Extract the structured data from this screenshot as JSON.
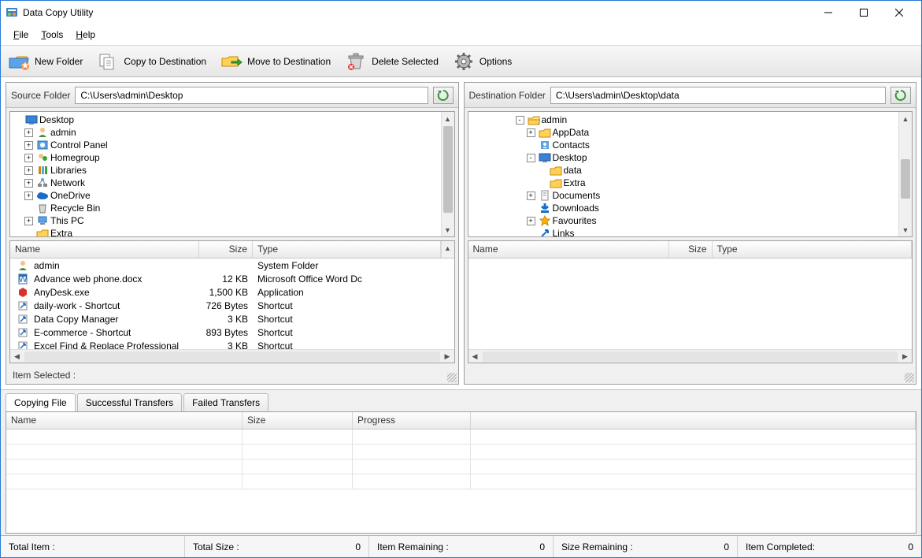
{
  "window": {
    "title": "Data Copy Utility"
  },
  "menu": {
    "file": "File",
    "tools": "Tools",
    "help": "Help"
  },
  "toolbar": {
    "new_folder": "New Folder",
    "copy": "Copy to Destination",
    "move": "Move to Destination",
    "delete": "Delete Selected",
    "options": "Options"
  },
  "source": {
    "label": "Source Folder",
    "path": "C:\\Users\\admin\\Desktop",
    "tree": [
      {
        "indent": 0,
        "exp": "",
        "icon": "desktop",
        "label": "Desktop"
      },
      {
        "indent": 1,
        "exp": "+",
        "icon": "user",
        "label": "admin"
      },
      {
        "indent": 1,
        "exp": "+",
        "icon": "cpl",
        "label": "Control Panel"
      },
      {
        "indent": 1,
        "exp": "+",
        "icon": "home",
        "label": "Homegroup"
      },
      {
        "indent": 1,
        "exp": "+",
        "icon": "lib",
        "label": "Libraries"
      },
      {
        "indent": 1,
        "exp": "+",
        "icon": "net",
        "label": "Network"
      },
      {
        "indent": 1,
        "exp": "+",
        "icon": "cloud",
        "label": "OneDrive"
      },
      {
        "indent": 1,
        "exp": "",
        "icon": "bin",
        "label": "Recycle Bin"
      },
      {
        "indent": 1,
        "exp": "+",
        "icon": "pc",
        "label": "This PC"
      },
      {
        "indent": 1,
        "exp": "",
        "icon": "folder",
        "label": "Extra"
      }
    ],
    "cols": {
      "name": "Name",
      "size": "Size",
      "type": "Type"
    },
    "items": [
      {
        "icon": "user",
        "name": "admin",
        "size": "",
        "type": "System Folder"
      },
      {
        "icon": "docx",
        "name": "Advance web phone.docx",
        "size": "12 KB",
        "type": "Microsoft Office Word Dc"
      },
      {
        "icon": "exe",
        "name": "AnyDesk.exe",
        "size": "1,500 KB",
        "type": "Application"
      },
      {
        "icon": "lnk",
        "name": "daily-work - Shortcut",
        "size": "726 Bytes",
        "type": "Shortcut"
      },
      {
        "icon": "lnk",
        "name": "Data Copy Manager",
        "size": "3 KB",
        "type": "Shortcut"
      },
      {
        "icon": "lnk",
        "name": "E-commerce - Shortcut",
        "size": "893 Bytes",
        "type": "Shortcut"
      },
      {
        "icon": "lnk",
        "name": "Excel Find & Replace Professional",
        "size": "3 KB",
        "type": "Shortcut"
      }
    ],
    "status": "Item Selected :"
  },
  "dest": {
    "label": "Destination Folder",
    "path": "C:\\Users\\admin\\Desktop\\data",
    "tree": [
      {
        "indent": 4,
        "exp": "-",
        "icon": "folder-open",
        "label": "admin"
      },
      {
        "indent": 5,
        "exp": "+",
        "icon": "folder",
        "label": "AppData"
      },
      {
        "indent": 5,
        "exp": "",
        "icon": "contacts",
        "label": "Contacts"
      },
      {
        "indent": 5,
        "exp": "-",
        "icon": "desktop",
        "label": "Desktop"
      },
      {
        "indent": 6,
        "exp": "",
        "icon": "folder",
        "label": "data"
      },
      {
        "indent": 6,
        "exp": "",
        "icon": "folder",
        "label": "Extra"
      },
      {
        "indent": 5,
        "exp": "+",
        "icon": "docs",
        "label": "Documents"
      },
      {
        "indent": 5,
        "exp": "",
        "icon": "download",
        "label": "Downloads"
      },
      {
        "indent": 5,
        "exp": "+",
        "icon": "star",
        "label": "Favourites"
      },
      {
        "indent": 5,
        "exp": "",
        "icon": "link",
        "label": "Links"
      }
    ],
    "cols": {
      "name": "Name",
      "size": "Size",
      "type": "Type"
    }
  },
  "tabs": {
    "copying": "Copying File",
    "success": "Successful Transfers",
    "failed": "Failed Transfers",
    "cols": {
      "name": "Name",
      "size": "Size",
      "progress": "Progress"
    }
  },
  "status": {
    "total_item_l": "Total Item :",
    "total_item_v": "",
    "total_size_l": "Total Size :",
    "total_size_v": "0",
    "remaining_l": "Item Remaining :",
    "remaining_v": "0",
    "size_remaining_l": "Size Remaining :",
    "size_remaining_v": "0",
    "completed_l": "Item Completed:",
    "completed_v": "0"
  },
  "colors": {
    "accent": "#2a7ad4",
    "folder": "#ffca4f"
  }
}
